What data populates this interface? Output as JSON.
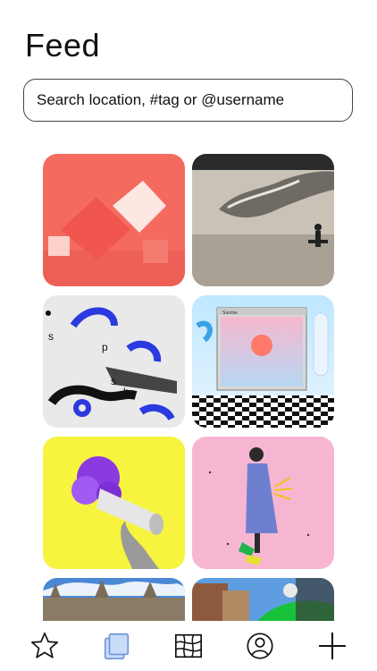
{
  "header": {
    "title": "Feed"
  },
  "search": {
    "placeholder": "Search location, #tag or @username"
  },
  "feed": {
    "tiles": [
      {
        "name": "tile-coral-cubes"
      },
      {
        "name": "tile-gallery-sculpture"
      },
      {
        "name": "tile-splash-collage"
      },
      {
        "name": "tile-vaporwave-window",
        "window_title": "Sunrise"
      },
      {
        "name": "tile-megaphone-flowers"
      },
      {
        "name": "tile-dancer-pink"
      },
      {
        "name": "tile-cathedral"
      },
      {
        "name": "tile-city-street"
      }
    ]
  },
  "tabbar": {
    "items": [
      {
        "icon": "star-icon"
      },
      {
        "icon": "feed-cards-icon",
        "active": true
      },
      {
        "icon": "map-icon"
      },
      {
        "icon": "profile-icon"
      },
      {
        "icon": "plus-icon"
      }
    ]
  }
}
